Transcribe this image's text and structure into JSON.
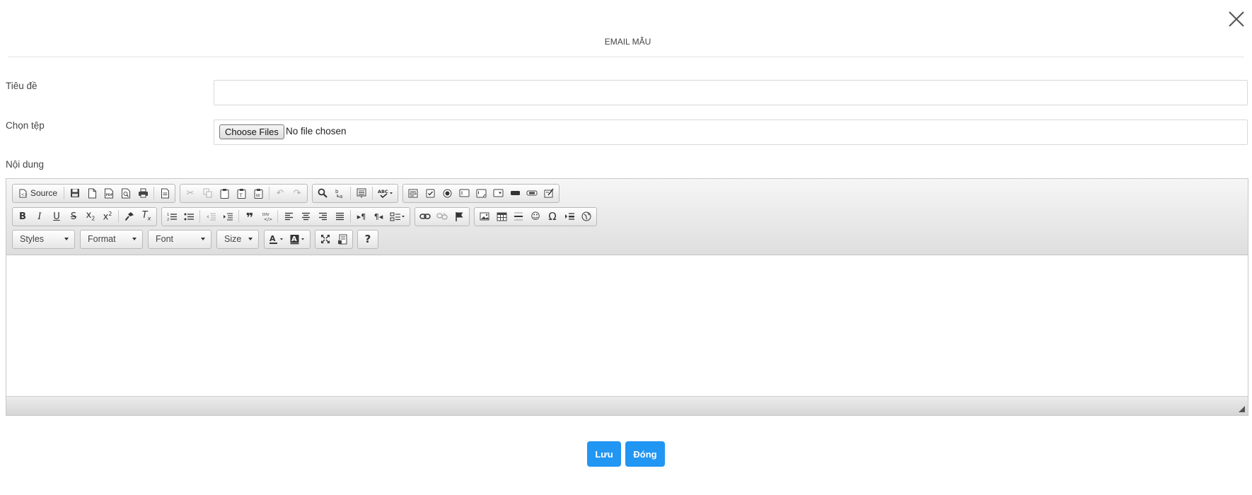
{
  "dialog": {
    "title": "EMAIL MẪU",
    "close_icon": "close-icon"
  },
  "form": {
    "subject_label": "Tiêu đề",
    "subject_value": "",
    "file_label": "Chọn tệp",
    "choose_button": "Choose Files",
    "file_status": "No file chosen",
    "content_label": "Nội dung"
  },
  "editor": {
    "source_label": "Source",
    "styles_label": "Styles",
    "format_label": "Format",
    "font_label": "Font",
    "size_label": "Size",
    "content": ""
  },
  "actions": {
    "save_label": "Lưu",
    "close_label": "Đóng"
  },
  "colors": {
    "primary_button": "#2196f3"
  }
}
